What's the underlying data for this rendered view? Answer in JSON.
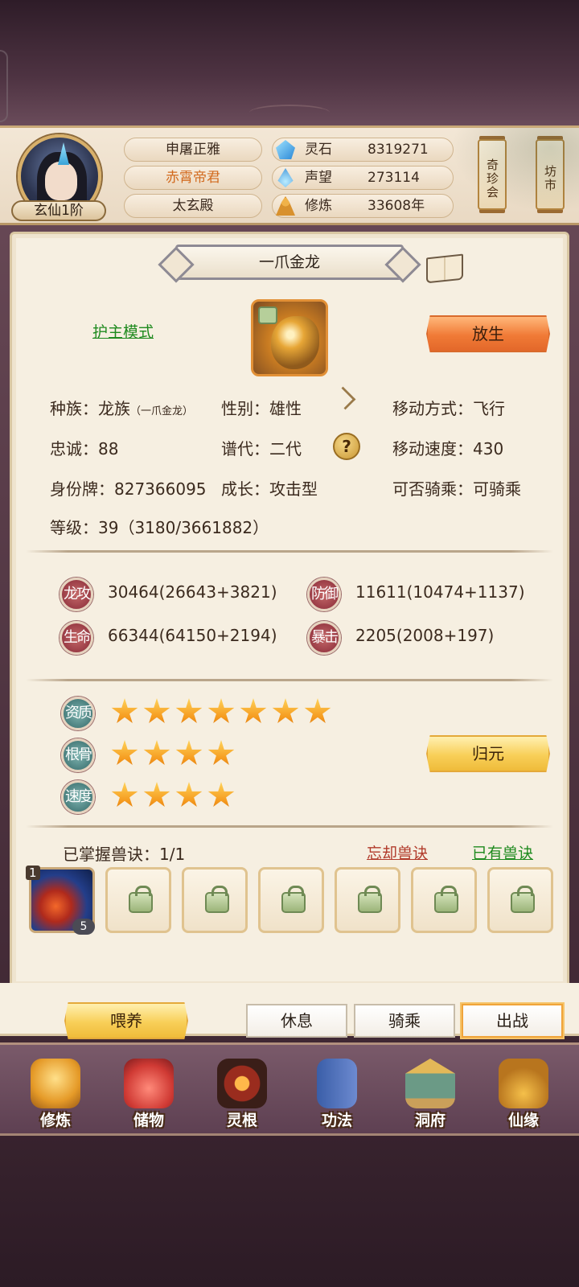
{
  "header": {
    "rank": "玄仙1阶",
    "names": [
      "申屠正雅",
      "赤霄帝君",
      "太玄殿"
    ],
    "resources": [
      {
        "icon": "spirit-stone-icon",
        "label": "灵石",
        "value": "8319271"
      },
      {
        "icon": "prestige-icon",
        "label": "声望",
        "value": "273114"
      },
      {
        "icon": "cultivation-icon",
        "label": "修炼",
        "value": "33608年"
      }
    ],
    "side_buttons": [
      "奇珍会",
      "坊市"
    ]
  },
  "pet": {
    "name": "一爪金龙",
    "guard_mode": "护主模式",
    "release_label": "放生",
    "info": {
      "race": "种族：龙族",
      "race_sub": "（一爪金龙）",
      "gender": "性别：雄性",
      "move_type": "移动方式：飞行",
      "loyalty": "忠诚：88",
      "generation": "谱代：二代",
      "move_speed": "移动速度：430",
      "id": "身份牌：827366095",
      "growth": "成长：攻击型",
      "rideable": "可否骑乘：可骑乘",
      "level": "等级：39（3180/3661882）"
    },
    "stats": [
      {
        "label": "龙攻",
        "value": "30464(26643+3821)"
      },
      {
        "label": "防御",
        "value": "11611(10474+1137)"
      },
      {
        "label": "生命",
        "value": "66344(64150+2194)"
      },
      {
        "label": "暴击",
        "value": "2205(2008+197)"
      }
    ],
    "ratings": [
      {
        "label": "资质",
        "stars": 7
      },
      {
        "label": "根骨",
        "stars": 4
      },
      {
        "label": "速度",
        "stars": 4
      }
    ],
    "restore_label": "归元",
    "skills": {
      "mastered": "已掌握兽诀：1/1",
      "forget_label": "忘却兽诀",
      "owned_label": "已有兽诀",
      "first_level": "1",
      "first_count": "5"
    }
  },
  "actions": {
    "feed": "喂养",
    "rest": "休息",
    "ride": "骑乘",
    "battle": "出战"
  },
  "nav": [
    "修炼",
    "储物",
    "灵根",
    "功法",
    "洞府",
    "仙缘"
  ]
}
